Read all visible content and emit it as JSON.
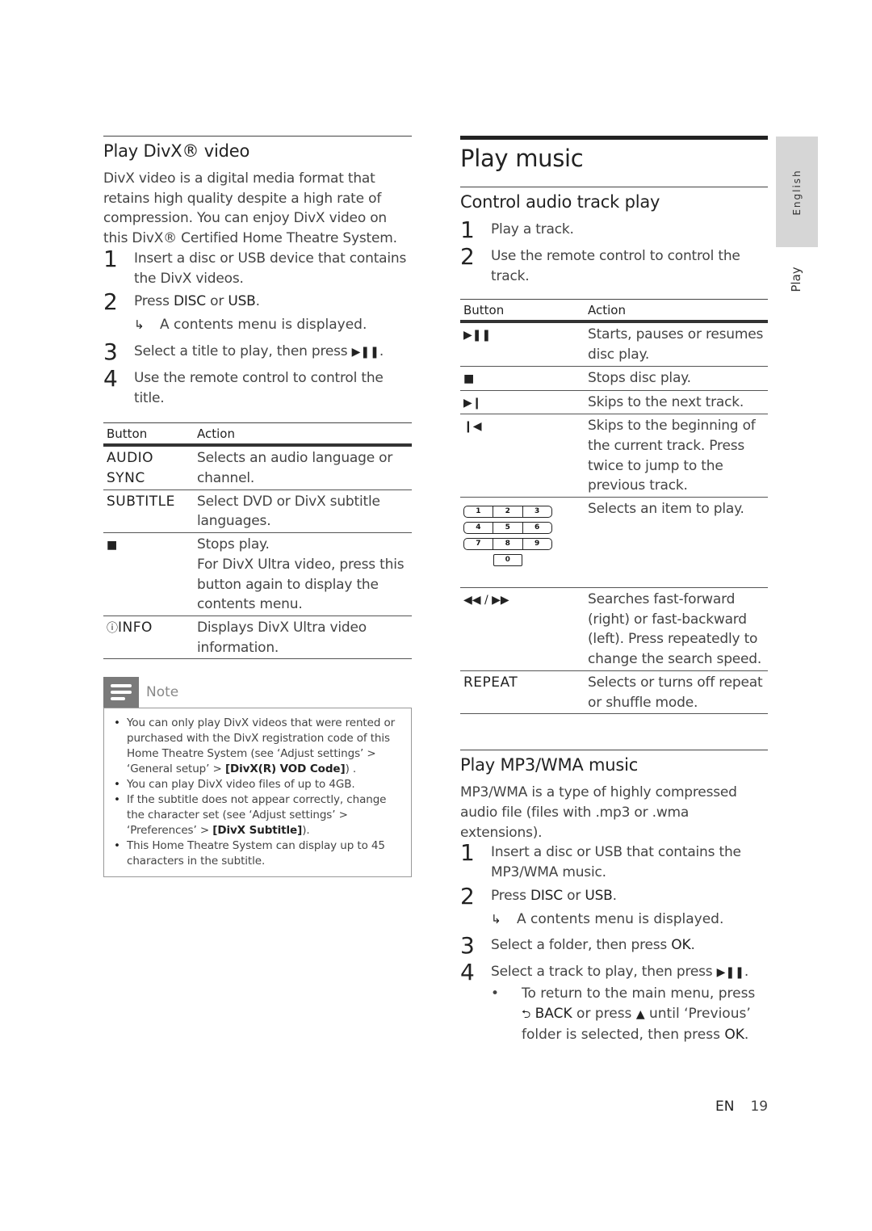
{
  "left": {
    "title": "Play DivX® video",
    "intro": "DivX video is a digital media format that retains high quality despite a high rate of compression. You can enjoy DivX video on this DivX® Certified Home Theatre System.",
    "steps": [
      {
        "num": "1",
        "text": "Insert a disc or USB device that contains the DivX videos."
      },
      {
        "num": "2",
        "text_pre": "Press ",
        "key1": "DISC",
        "mid": " or ",
        "key2": "USB",
        "post": ".",
        "sub": "A contents menu is displayed."
      },
      {
        "num": "3",
        "text": "Select a title to play, then press ",
        "icon": "▶❚❚",
        "post": "."
      },
      {
        "num": "4",
        "text": "Use the remote control to control the title."
      }
    ],
    "table": {
      "headers": [
        "Button",
        "Action"
      ],
      "rows": [
        {
          "button": "AUDIO SYNC",
          "action": "Selects an audio language or channel."
        },
        {
          "button": "SUBTITLE",
          "action": "Select DVD or DivX subtitle languages."
        },
        {
          "button_icon": "■",
          "action": "Stops play.",
          "action2": "For DivX Ultra video, press this button again to display the contents menu."
        },
        {
          "button_icon": "ⓘ",
          "button": "INFO",
          "action": "Displays DivX Ultra video information."
        }
      ]
    },
    "note": {
      "title": "Note",
      "items": [
        {
          "text": "You can only play DivX videos that were rented or purchased with the DivX registration code of this Home Theatre System (see ‘Adjust settings’ > ‘General setup’ > ",
          "bold": "[DivX(R) VOD Code]",
          "post": ") ."
        },
        {
          "text": "You can play DivX video files of up to 4GB."
        },
        {
          "text": "If the subtitle does not appear correctly, change the character set (see ‘Adjust settings’ > ‘Preferences’ > ",
          "bold": "[DivX Subtitle]",
          "post": ")."
        },
        {
          "text": "This Home Theatre System can display up to 45 characters in the subtitle."
        }
      ]
    }
  },
  "right": {
    "title": "Play music",
    "section1": {
      "title": "Control audio track play",
      "steps": [
        {
          "num": "1",
          "text": "Play a track."
        },
        {
          "num": "2",
          "text": "Use the remote control to control the track."
        }
      ],
      "table": {
        "headers": [
          "Button",
          "Action"
        ],
        "rows": [
          {
            "button_icon": "▶❚❚",
            "action": "Starts, pauses or resumes disc play."
          },
          {
            "button_icon": "■",
            "action": "Stops disc play."
          },
          {
            "button_icon": "▶❙",
            "action": "Skips to the next track."
          },
          {
            "button_icon": "❙◀",
            "action": "Skips to the beginning of the current track. Press twice to jump to the previous track."
          },
          {
            "keypad": [
              [
                "1",
                "2",
                "3"
              ],
              [
                "4",
                "5",
                "6"
              ],
              [
                "7",
                "8",
                "9"
              ],
              [
                "0"
              ]
            ],
            "action": "Selects an item to play."
          },
          {
            "button_icon": "◀◀ / ▶▶",
            "action": "Searches fast-forward (right) or fast-backward (left). Press repeatedly to change the search speed."
          },
          {
            "button": "REPEAT",
            "action": "Selects or turns off repeat or shuffle mode."
          }
        ]
      }
    },
    "section2": {
      "title": "Play MP3/WMA music",
      "intro": "MP3/WMA is a type of highly compressed audio file (files with .mp3 or .wma extensions).",
      "steps": [
        {
          "num": "1",
          "text": "Insert a disc or USB that contains the MP3/WMA music."
        },
        {
          "num": "2",
          "text_pre": "Press ",
          "key1": "DISC",
          "mid": " or ",
          "key2": "USB",
          "post": ".",
          "sub": "A contents menu is displayed."
        },
        {
          "num": "3",
          "text": "Select a folder, then press ",
          "key": "OK",
          "post": "."
        },
        {
          "num": "4",
          "text": "Select a track to play, then press ",
          "icon": "▶❚❚",
          "post": "."
        }
      ],
      "bullet": {
        "pre": "To return to the main menu, press ",
        "back_icon": "⮌",
        "back": "BACK",
        "mid": " or press ",
        "up_icon": "▲",
        "post": " until ‘Previous’ folder is selected, then press ",
        "ok": "OK",
        "end": "."
      }
    }
  },
  "side": {
    "language_tab": "English",
    "chapter_tab": "Play"
  },
  "footer": {
    "lang": "EN",
    "page": "19"
  }
}
